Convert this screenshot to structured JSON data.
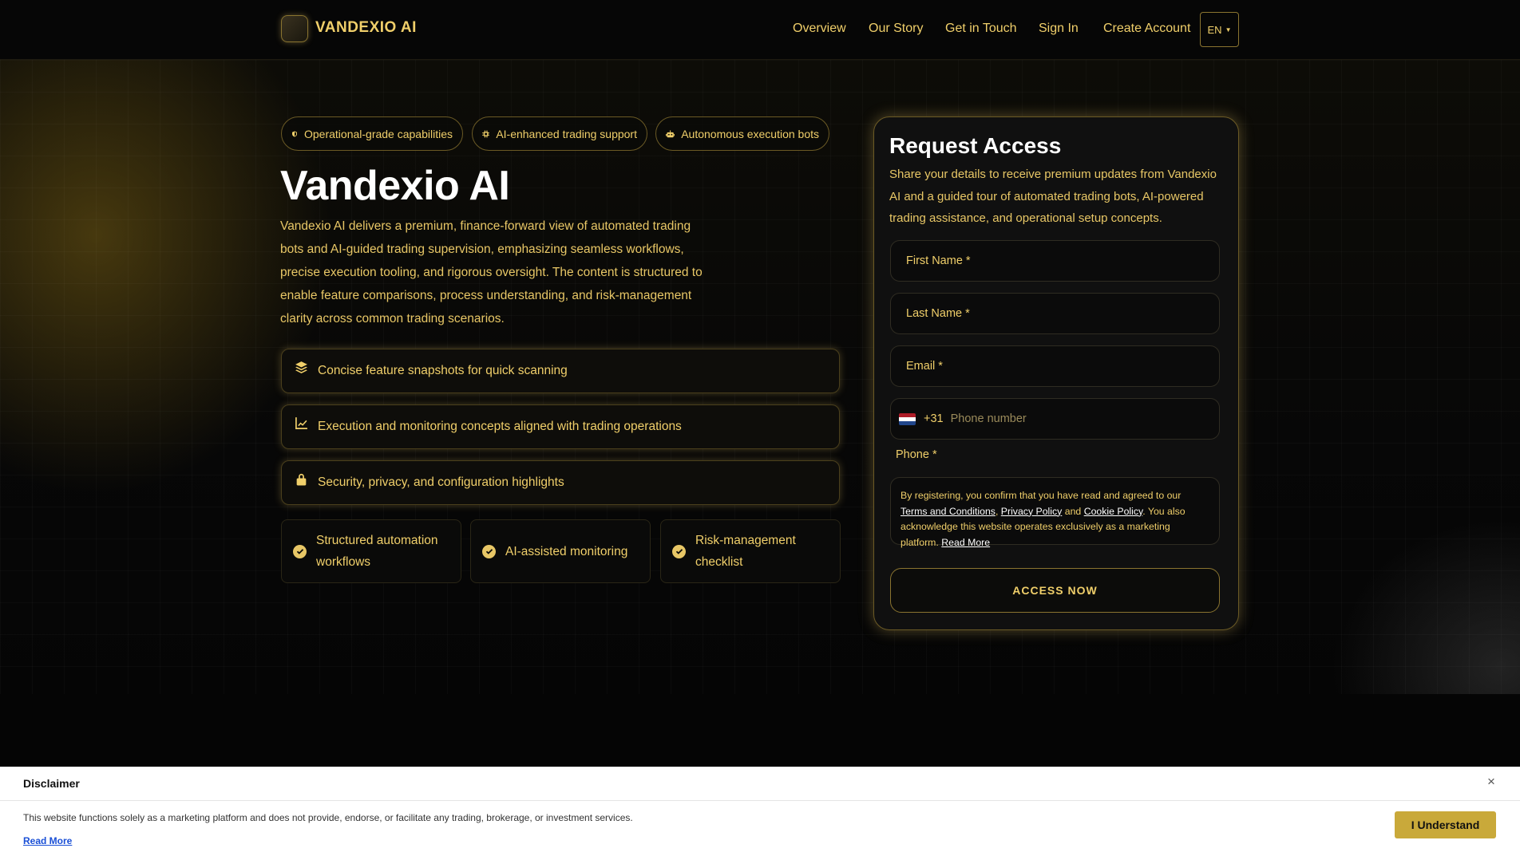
{
  "header": {
    "brand": "VANDEXIO AI",
    "nav": [
      "Overview",
      "Our Story",
      "Get in Touch",
      "Sign In",
      "Create Account"
    ],
    "lang": "EN"
  },
  "hero": {
    "pills": [
      "Operational-grade capabilities",
      "AI-enhanced trading support",
      "Autonomous execution bots"
    ],
    "title": "Vandexio AI",
    "description": "Vandexio AI delivers a premium, finance-forward view of automated trading bots and AI-guided trading supervision, emphasizing seamless workflows, precise execution tooling, and rigorous oversight. The content is structured to enable feature comparisons, process understanding, and risk-management clarity across common trading scenarios.",
    "features": [
      "Concise feature snapshots for quick scanning",
      "Execution and monitoring concepts aligned with trading operations",
      "Security, privacy, and configuration highlights"
    ],
    "checks": [
      "Structured automation workflows",
      "AI-assisted monitoring",
      "Risk-management checklist"
    ]
  },
  "form": {
    "title": "Request Access",
    "description": "Share your details to receive premium updates from Vandexio AI and a guided tour of automated trading bots, AI-powered trading assistance, and operational setup concepts.",
    "first_name": "First Name *",
    "last_name": "Last Name *",
    "email": "Email *",
    "phone_code": "+31",
    "phone_placeholder": "Phone number",
    "phone_label": "Phone *",
    "consent_pre": "By registering, you confirm that you have read and agreed to our ",
    "terms": "Terms and Conditions",
    "comma": ", ",
    "privacy": "Privacy Policy",
    "and": " and ",
    "cookie": "Cookie Policy",
    "consent_post": ". You also acknowledge this website operates exclusively as a marketing platform. ",
    "read_more": "Read More",
    "submit": "ACCESS NOW"
  },
  "disclaimer": {
    "title": "Disclaimer",
    "text": "This website functions solely as a marketing platform and does not provide, endorse, or facilitate any trading, brokerage, or investment services.",
    "read_more": "Read More",
    "button": "I Understand",
    "close": "×"
  },
  "colors": {
    "accent": "#e8c766",
    "background": "#050505",
    "button_gold": "#c9a93a"
  }
}
